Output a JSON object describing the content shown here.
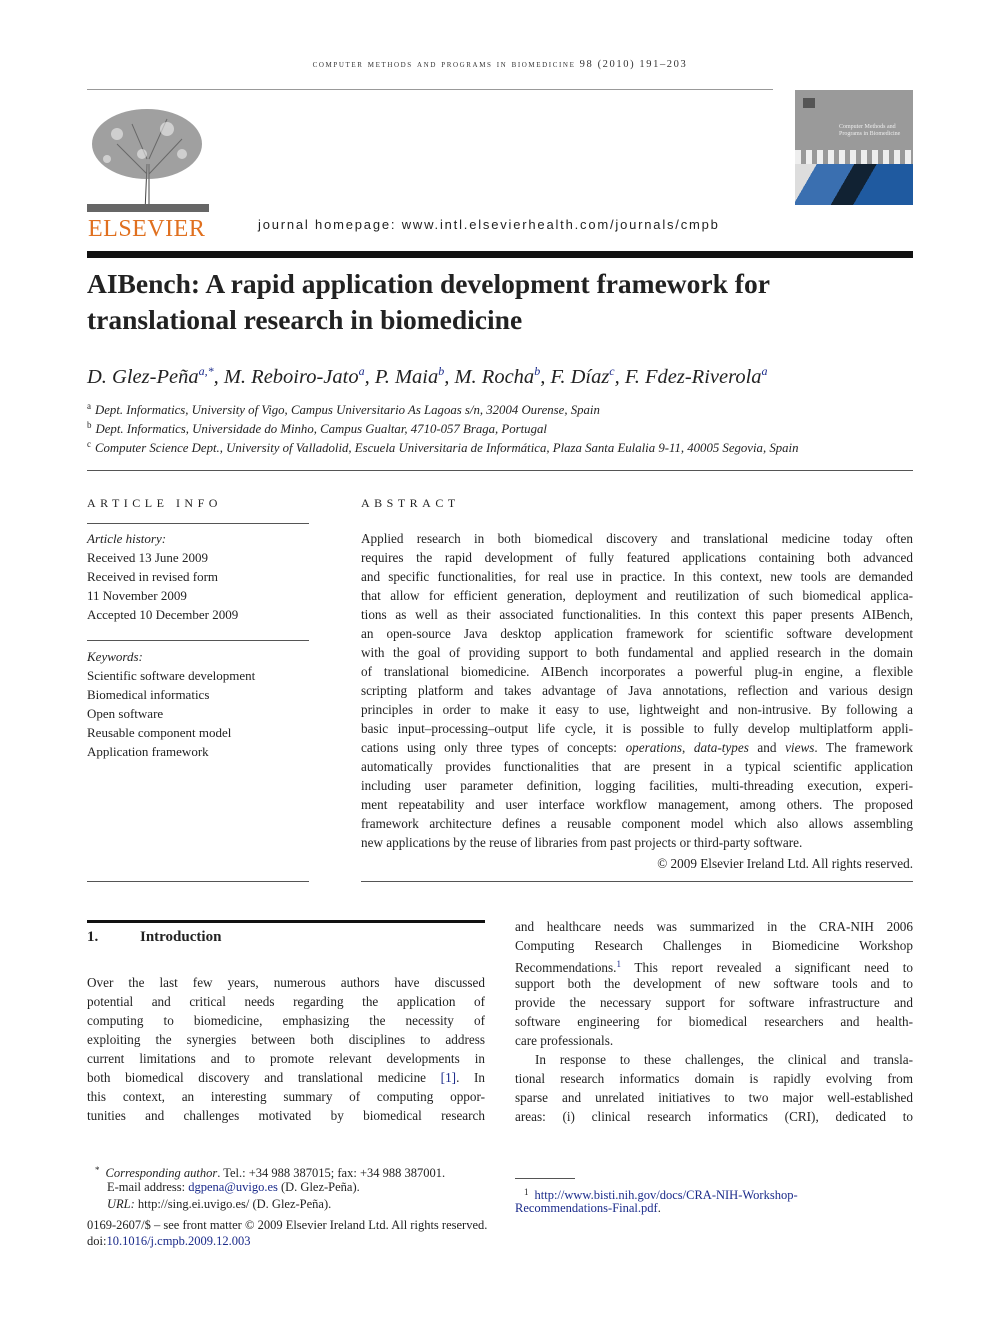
{
  "running_head": "computer methods and programs in biomedicine 98 (2010) 191–203",
  "publisher_logo": "ELSEVIER",
  "journal_homepage": "journal homepage: www.intl.elsevierhealth.com/journals/cmpb",
  "cover_title": "Computer Methods and Programs in Biomedicine",
  "title_lines": [
    "AIBench: A rapid application development framework for",
    "translational research in biomedicine"
  ],
  "authors": [
    {
      "name": "D. Glez-Peña",
      "aff": "a,*"
    },
    {
      "name": "M. Reboiro-Jato",
      "aff": "a"
    },
    {
      "name": "P. Maia",
      "aff": "b"
    },
    {
      "name": "M. Rocha",
      "aff": "b"
    },
    {
      "name": "F. Díaz",
      "aff": "c"
    },
    {
      "name": "F. Fdez-Riverola",
      "aff": "a"
    }
  ],
  "affiliations": [
    {
      "mark": "a",
      "text": "Dept. Informatics, University of Vigo, Campus Universitario As Lagoas s/n, 32004 Ourense, Spain"
    },
    {
      "mark": "b",
      "text": "Dept. Informatics, Universidade do Minho, Campus Gualtar, 4710-057 Braga, Portugal"
    },
    {
      "mark": "c",
      "text": "Computer Science Dept., University of Valladolid, Escuela Universitaria de Informática, Plaza Santa Eulalia 9-11, 40005 Segovia, Spain"
    }
  ],
  "article_info": {
    "heading": "ARTICLE INFO",
    "history_label": "Article history:",
    "history": [
      "Received 13 June 2009",
      "Received in revised form",
      "11 November 2009",
      "Accepted 10 December 2009"
    ],
    "keywords_label": "Keywords:",
    "keywords": [
      "Scientific software development",
      "Biomedical informatics",
      "Open software",
      "Reusable component model",
      "Application framework"
    ]
  },
  "abstract": {
    "heading": "ABSTRACT",
    "lines": [
      [
        {
          "t": "Applied research in both biomedical discovery and translational medicine today often"
        }
      ],
      [
        {
          "t": "requires the rapid development of fully featured applications containing both advanced"
        }
      ],
      [
        {
          "t": "and specific functionalities, for real use in practice. In this context, new tools are demanded"
        }
      ],
      [
        {
          "t": "that allow for efficient generation, deployment and reutilization of such biomedical applica-"
        }
      ],
      [
        {
          "t": "tions as well as their associated functionalities. In this context this paper presents AIBench,"
        }
      ],
      [
        {
          "t": "an open-source Java desktop application framework for scientific software development"
        }
      ],
      [
        {
          "t": "with the goal of providing support to both fundamental and applied research in the domain"
        }
      ],
      [
        {
          "t": "of translational biomedicine. AIBench incorporates a powerful plug-in engine, a flexible"
        }
      ],
      [
        {
          "t": "scripting platform and takes advantage of Java annotations, reflection and various design"
        }
      ],
      [
        {
          "t": "principles in order to make it easy to use, lightweight and non-intrusive. By following a"
        }
      ],
      [
        {
          "t": "basic input–processing–output life cycle, it is possible to fully develop multiplatform appli-"
        }
      ],
      [
        {
          "t": "cations using only three types of concepts: "
        },
        {
          "t": "operations",
          "s": "it"
        },
        {
          "t": ", "
        },
        {
          "t": "data-types",
          "s": "it"
        },
        {
          "t": " and "
        },
        {
          "t": "views",
          "s": "it"
        },
        {
          "t": ". The framework"
        }
      ],
      [
        {
          "t": "automatically provides functionalities that are present in a typical scientific application"
        }
      ],
      [
        {
          "t": "including user parameter definition, logging facilities, multi-threading execution, experi-"
        }
      ],
      [
        {
          "t": "ment repeatability and user interface workflow management, among others. The proposed"
        }
      ],
      [
        {
          "t": "framework architecture defines a reusable component model which also allows assembling"
        }
      ],
      [
        {
          "t": "new applications by the reuse of libraries from past projects or third-party software."
        }
      ]
    ],
    "copyright": "© 2009 Elsevier Ireland Ltd. All rights reserved."
  },
  "introduction": {
    "number": "1.",
    "heading": "Introduction",
    "left_lines": [
      [
        {
          "t": "Over the last few years, numerous authors have discussed"
        }
      ],
      [
        {
          "t": "potential and critical needs regarding the application of"
        }
      ],
      [
        {
          "t": "computing to biomedicine, emphasizing the necessity of"
        }
      ],
      [
        {
          "t": "exploiting the synergies between both disciplines to address"
        }
      ],
      [
        {
          "t": "current limitations and to promote relevant developments in"
        }
      ],
      [
        {
          "t": "both biomedical discovery and translational medicine "
        },
        {
          "t": "[1]",
          "s": "lnk"
        },
        {
          "t": ". In"
        }
      ],
      [
        {
          "t": "this context, an interesting summary of computing oppor-"
        }
      ],
      [
        {
          "t": "tunities and challenges motivated by biomedical research"
        }
      ]
    ],
    "right_lines": [
      [
        {
          "t": "and healthcare needs was summarized in the CRA-NIH 2006"
        }
      ],
      [
        {
          "t": "Computing Research Challenges in Biomedicine Workshop"
        }
      ],
      [
        {
          "t": "Recommendations."
        },
        {
          "t": "1",
          "s": "sp"
        },
        {
          "t": " This report revealed a significant need to"
        }
      ],
      [
        {
          "t": "support both the development of new software tools and to"
        }
      ],
      [
        {
          "t": "provide the necessary support for software infrastructure and"
        }
      ],
      [
        {
          "t": "software engineering for biomedical researchers and health-"
        }
      ],
      [
        {
          "t": "care professionals."
        }
      ],
      [
        {
          "t": "In response to these challenges, the clinical and transla-"
        }
      ],
      [
        {
          "t": "tional research informatics domain is rapidly evolving from"
        }
      ],
      [
        {
          "t": "sparse and unrelated initiatives to two major well-established"
        }
      ],
      [
        {
          "t": "areas: (i) clinical research informatics (CRI), dedicated to"
        }
      ]
    ]
  },
  "footnotes": {
    "corresponding_mark": "*",
    "corresponding_label": "Corresponding author",
    "phone": ". Tel.: +34 988 387015; fax: +34 988 387001.",
    "email_label": "E-mail address: ",
    "email": "dgpena@uvigo.es",
    "email_owner": " (D. Glez-Peña).",
    "url_label": "URL:",
    "url": " http://sing.ei.uvigo.es/ (D. Glez-Peña).",
    "fn1_mark": "1",
    "fn1_line1": "http://www.bisti.nih.gov/docs/CRA-NIH-Workshop-",
    "fn1_line2": "Recommendations-Final.pdf",
    "fn1_end": "."
  },
  "front_matter": "0169-2607/$ – see front matter © 2009 Elsevier Ireland Ltd. All rights reserved.",
  "doi_label": "doi:",
  "doi": "10.1016/j.cmpb.2009.12.003",
  "colors": {
    "link": "#1a2a8a",
    "elsevier_orange": "#e0701f",
    "rule_dark": "#111111"
  }
}
